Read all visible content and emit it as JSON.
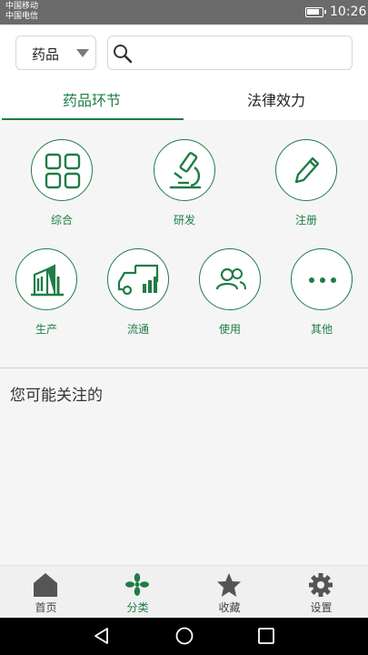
{
  "status_bar": {
    "carrier_1": "中国移动",
    "carrier_2": "中国电信",
    "time": "10:26",
    "battery_level": 0.85
  },
  "search": {
    "category_selected": "药品",
    "placeholder": ""
  },
  "tabs": [
    {
      "label": "药品环节",
      "active": true
    },
    {
      "label": "法律效力",
      "active": false
    }
  ],
  "categories": {
    "row1": [
      {
        "label": "综合",
        "icon": "grid-icon"
      },
      {
        "label": "研发",
        "icon": "microscope-icon"
      },
      {
        "label": "注册",
        "icon": "pencil-icon"
      }
    ],
    "row2": [
      {
        "label": "生产",
        "icon": "factory-icon"
      },
      {
        "label": "流通",
        "icon": "truck-icon"
      },
      {
        "label": "使用",
        "icon": "users-icon"
      },
      {
        "label": "其他",
        "icon": "more-icon"
      }
    ]
  },
  "section": {
    "title": "您可能关注的"
  },
  "bottom_nav": [
    {
      "label": "首页",
      "icon": "home-icon",
      "active": false
    },
    {
      "label": "分类",
      "icon": "clover-icon",
      "active": true
    },
    {
      "label": "收藏",
      "icon": "star-icon",
      "active": false
    },
    {
      "label": "设置",
      "icon": "gear-icon",
      "active": false
    }
  ],
  "colors": {
    "accent": "#1e7d46",
    "status_bar": "#6b6b6b",
    "nav_inactive": "#555555"
  }
}
